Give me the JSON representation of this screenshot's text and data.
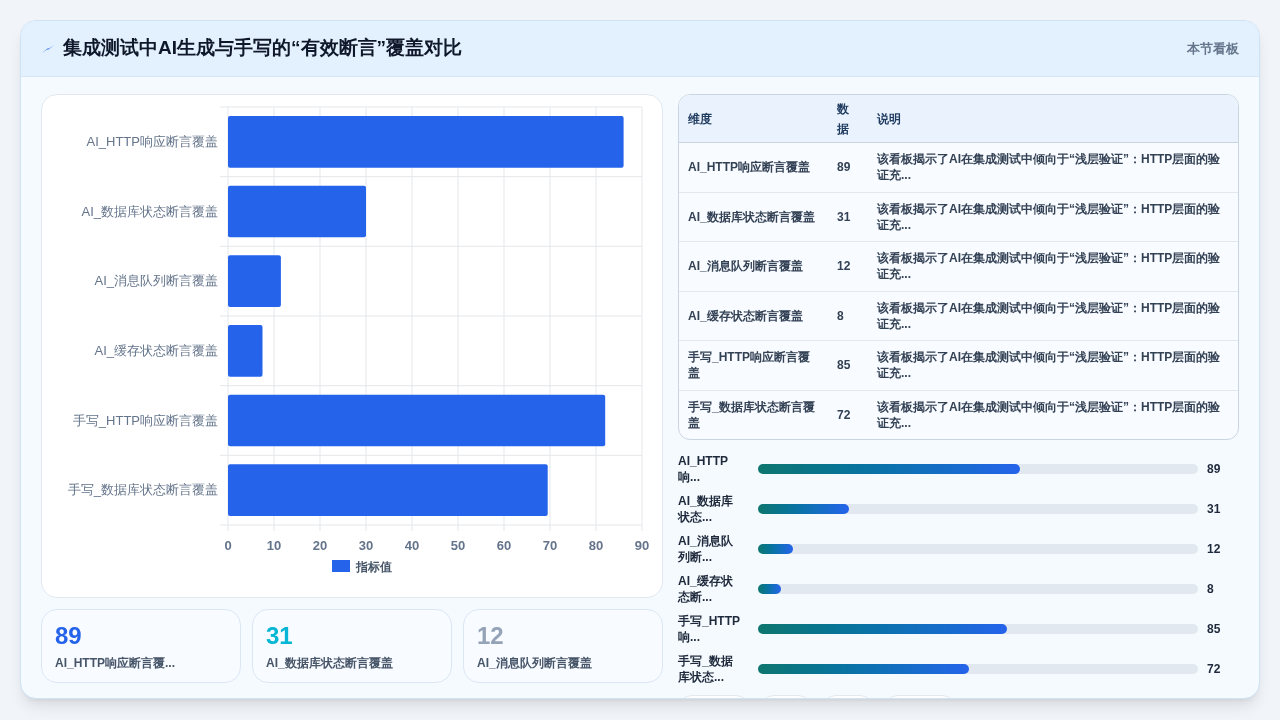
{
  "header": {
    "title": "集成测试中AI生成与手写的“有效断言”覆盖对比",
    "link": "本节看板"
  },
  "chart": {
    "chart_data": {
      "type": "bar",
      "orientation": "horizontal",
      "categories": [
        "AI_HTTP响应断言覆盖",
        "AI_数据库状态断言覆盖",
        "AI_消息队列断言覆盖",
        "AI_缓存状态断言覆盖",
        "手写_HTTP响应断言覆盖",
        "手写_数据库状态断言覆盖"
      ],
      "series": [
        {
          "name": "指标值",
          "color": "#2563eb",
          "values": [
            86,
            30,
            11.5,
            7.5,
            82,
            69.5
          ]
        }
      ],
      "xlim": [
        0,
        90
      ],
      "grid": true,
      "xticks": [
        0,
        10,
        20,
        30,
        40,
        50,
        60,
        70,
        80,
        90
      ]
    }
  },
  "stats": [
    {
      "value": "89",
      "label": "AI_HTTP响应断言覆...",
      "color": "#2563eb"
    },
    {
      "value": "31",
      "label": "AI_数据库状态断言覆盖",
      "color": "#06b6d4"
    },
    {
      "value": "12",
      "label": "AI_消息队列断言覆盖",
      "color": "#94a3b8"
    }
  ],
  "table": {
    "columns": [
      "维度",
      "数据",
      "说明"
    ],
    "rows": [
      [
        "AI_HTTP响应断言覆盖",
        "89",
        "该看板揭示了AI在集成测试中倾向于“浅层验证”：HTTP层面的验证充..."
      ],
      [
        "AI_数据库状态断言覆盖",
        "31",
        "该看板揭示了AI在集成测试中倾向于“浅层验证”：HTTP层面的验证充..."
      ],
      [
        "AI_消息队列断言覆盖",
        "12",
        "该看板揭示了AI在集成测试中倾向于“浅层验证”：HTTP层面的验证充..."
      ],
      [
        "AI_缓存状态断言覆盖",
        "8",
        "该看板揭示了AI在集成测试中倾向于“浅层验证”：HTTP层面的验证充..."
      ],
      [
        "手写_HTTP响应断言覆盖",
        "85",
        "该看板揭示了AI在集成测试中倾向于“浅层验证”：HTTP层面的验证充..."
      ],
      [
        "手写_数据库状态断言覆盖",
        "72",
        "该看板揭示了AI在集成测试中倾向于“浅层验证”：HTTP层面的验证充..."
      ]
    ]
  },
  "meters": [
    {
      "label": "AI_HTTP响...",
      "level": 0.595,
      "reading": "89"
    },
    {
      "label": "AI_数据库状态...",
      "level": 0.207,
      "reading": "31"
    },
    {
      "label": "AI_消息队列断...",
      "level": 0.08,
      "reading": "12"
    },
    {
      "label": "AI_缓存状态断...",
      "level": 0.053,
      "reading": "8"
    },
    {
      "label": "手写_HTTP响...",
      "level": 0.567,
      "reading": "85"
    },
    {
      "label": "手写_数据库状态...",
      "level": 0.48,
      "reading": "72"
    }
  ],
  "chips": [
    {
      "kind": "chip"
    },
    {
      "kind": "chip"
    },
    {
      "kind": "chip"
    },
    {
      "kind": "chip"
    }
  ]
}
